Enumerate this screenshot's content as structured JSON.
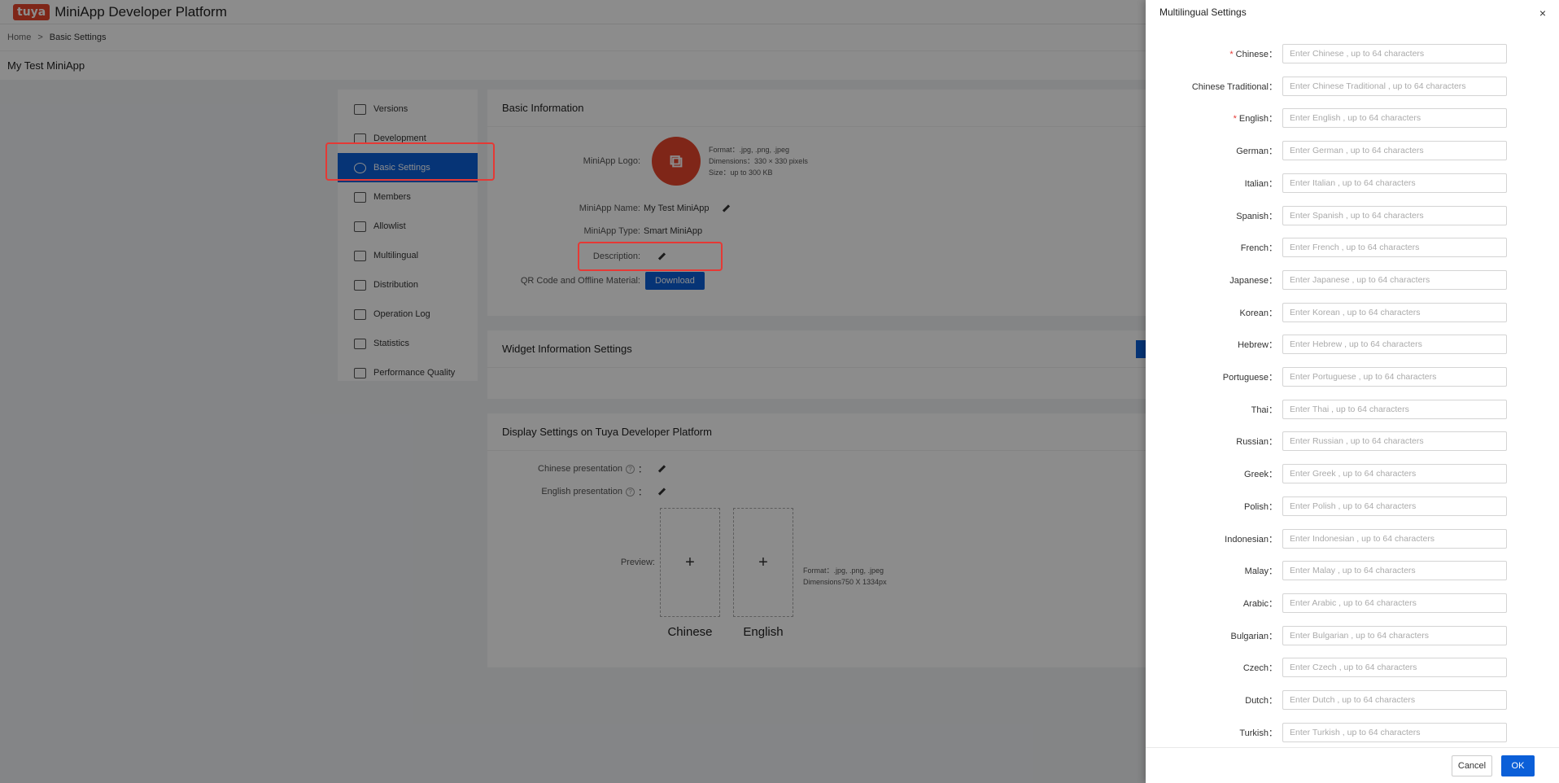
{
  "header": {
    "logo": "tuya",
    "title": "MiniApp Developer Platform"
  },
  "breadcrumb": {
    "home": "Home",
    "separator": ">",
    "current": "Basic Settings"
  },
  "subheader": {
    "title": "My Test MiniApp"
  },
  "sidebar": {
    "items": [
      {
        "label": "Versions",
        "icon": "versions-icon"
      },
      {
        "label": "Development",
        "icon": "terminal-icon"
      },
      {
        "label": "Basic Settings",
        "icon": "gear-icon",
        "active": true
      },
      {
        "label": "Members",
        "icon": "members-icon"
      },
      {
        "label": "Allowlist",
        "icon": "allowlist-icon"
      },
      {
        "label": "Multilingual",
        "icon": "globe-icon"
      },
      {
        "label": "Distribution",
        "icon": "distribution-icon"
      },
      {
        "label": "Operation Log",
        "icon": "log-icon"
      },
      {
        "label": "Statistics",
        "icon": "chart-icon"
      },
      {
        "label": "Performance Quality",
        "icon": "performance-icon"
      }
    ]
  },
  "basic_info": {
    "title": "Basic Information",
    "logo_label": "MiniApp Logo:",
    "logo_format": "Format：.jpg, .png, .jpeg",
    "logo_dimensions": "Dimensions：330 × 330 pixels",
    "logo_size": "Size：up to 300 KB",
    "name_label": "MiniApp Name:",
    "name_value": "My Test MiniApp",
    "type_label": "MiniApp Type:",
    "type_value": "Smart MiniApp",
    "description_label": "Description:",
    "qr_label": "QR Code and Offline Material:",
    "download_button": "Download"
  },
  "widget_info": {
    "title": "Widget Information Settings"
  },
  "display_settings": {
    "title": "Display Settings on Tuya Developer Platform",
    "chinese_label": "Chinese presentation",
    "english_label": "English presentation",
    "help_glyph": "?",
    "colon": "：",
    "preview_label": "Preview:",
    "upload_plus": "+",
    "chinese_caption": "Chinese",
    "english_caption": "English",
    "format_info": "Format：.jpg, .png, .jpeg",
    "dimensions_info": "Dimensions750 X 1334px"
  },
  "drawer": {
    "title": "Multilingual Settings",
    "close": "×",
    "cancel_label": "Cancel",
    "ok_label": "OK",
    "fields": [
      {
        "label": "Chinese",
        "required": true,
        "placeholder": "Enter Chinese , up to 64 characters"
      },
      {
        "label": "Chinese Traditional",
        "required": false,
        "placeholder": "Enter Chinese Traditional , up to 64 characters"
      },
      {
        "label": "English",
        "required": true,
        "placeholder": "Enter English , up to 64 characters"
      },
      {
        "label": "German",
        "required": false,
        "placeholder": "Enter German , up to 64 characters"
      },
      {
        "label": "Italian",
        "required": false,
        "placeholder": "Enter Italian , up to 64 characters"
      },
      {
        "label": "Spanish",
        "required": false,
        "placeholder": "Enter Spanish , up to 64 characters"
      },
      {
        "label": "French",
        "required": false,
        "placeholder": "Enter French , up to 64 characters"
      },
      {
        "label": "Japanese",
        "required": false,
        "placeholder": "Enter Japanese , up to 64 characters"
      },
      {
        "label": "Korean",
        "required": false,
        "placeholder": "Enter Korean , up to 64 characters"
      },
      {
        "label": "Hebrew",
        "required": false,
        "placeholder": "Enter Hebrew , up to 64 characters"
      },
      {
        "label": "Portuguese",
        "required": false,
        "placeholder": "Enter Portuguese , up to 64 characters"
      },
      {
        "label": "Thai",
        "required": false,
        "placeholder": "Enter Thai , up to 64 characters"
      },
      {
        "label": "Russian",
        "required": false,
        "placeholder": "Enter Russian , up to 64 characters"
      },
      {
        "label": "Greek",
        "required": false,
        "placeholder": "Enter Greek , up to 64 characters"
      },
      {
        "label": "Polish",
        "required": false,
        "placeholder": "Enter Polish , up to 64 characters"
      },
      {
        "label": "Indonesian",
        "required": false,
        "placeholder": "Enter Indonesian , up to 64 characters"
      },
      {
        "label": "Malay",
        "required": false,
        "placeholder": "Enter Malay , up to 64 characters"
      },
      {
        "label": "Arabic",
        "required": false,
        "placeholder": "Enter Arabic , up to 64 characters"
      },
      {
        "label": "Bulgarian",
        "required": false,
        "placeholder": "Enter Bulgarian , up to 64 characters"
      },
      {
        "label": "Czech",
        "required": false,
        "placeholder": "Enter Czech , up to 64 characters"
      },
      {
        "label": "Dutch",
        "required": false,
        "placeholder": "Enter Dutch , up to 64 characters"
      },
      {
        "label": "Turkish",
        "required": false,
        "placeholder": "Enter Turkish , up to 64 characters"
      }
    ]
  },
  "colors": {
    "accent": "#0b5fd8",
    "brand": "#e8452c",
    "highlight": "#e53935"
  }
}
